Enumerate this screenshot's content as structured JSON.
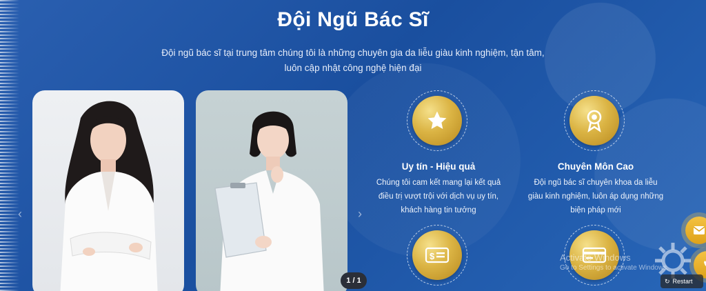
{
  "section": {
    "title": "Đội Ngũ Bác Sĩ",
    "subtitle": "Đội ngũ bác sĩ tại trung tâm chúng tôi là những chuyên gia da liễu giàu kinh nghiệm, tận tâm, luôn cập nhật công nghệ hiện đại"
  },
  "slider": {
    "pager": "1 / 1",
    "prev_icon": "chevron-left-icon",
    "next_icon": "chevron-right-icon"
  },
  "features": [
    {
      "icon": "star-icon",
      "title": "Uy tín - Hiệu quả",
      "text": "Chúng tôi cam kết mang lại kết quả điều trị vượt trội với dịch vụ uy tín,  khách hàng tin tưởng"
    },
    {
      "icon": "award-badge-icon",
      "title": "Chuyên Môn Cao",
      "text": "Đội ngũ bác sĩ chuyên khoa da liễu giàu kinh nghiệm, luôn áp dụng những biện pháp mới"
    },
    {
      "icon": "money-icon",
      "title": "",
      "text": ""
    },
    {
      "icon": "credit-card-icon",
      "title": "",
      "text": ""
    }
  ],
  "overlay": {
    "watermark_title": "Activate Windows",
    "watermark_sub": "Go to Settings to activate Windows.",
    "restart_label": "Restart"
  },
  "colors": {
    "background": "#1d55a8",
    "gold": "#dbb444",
    "fab": "#f4c243"
  }
}
